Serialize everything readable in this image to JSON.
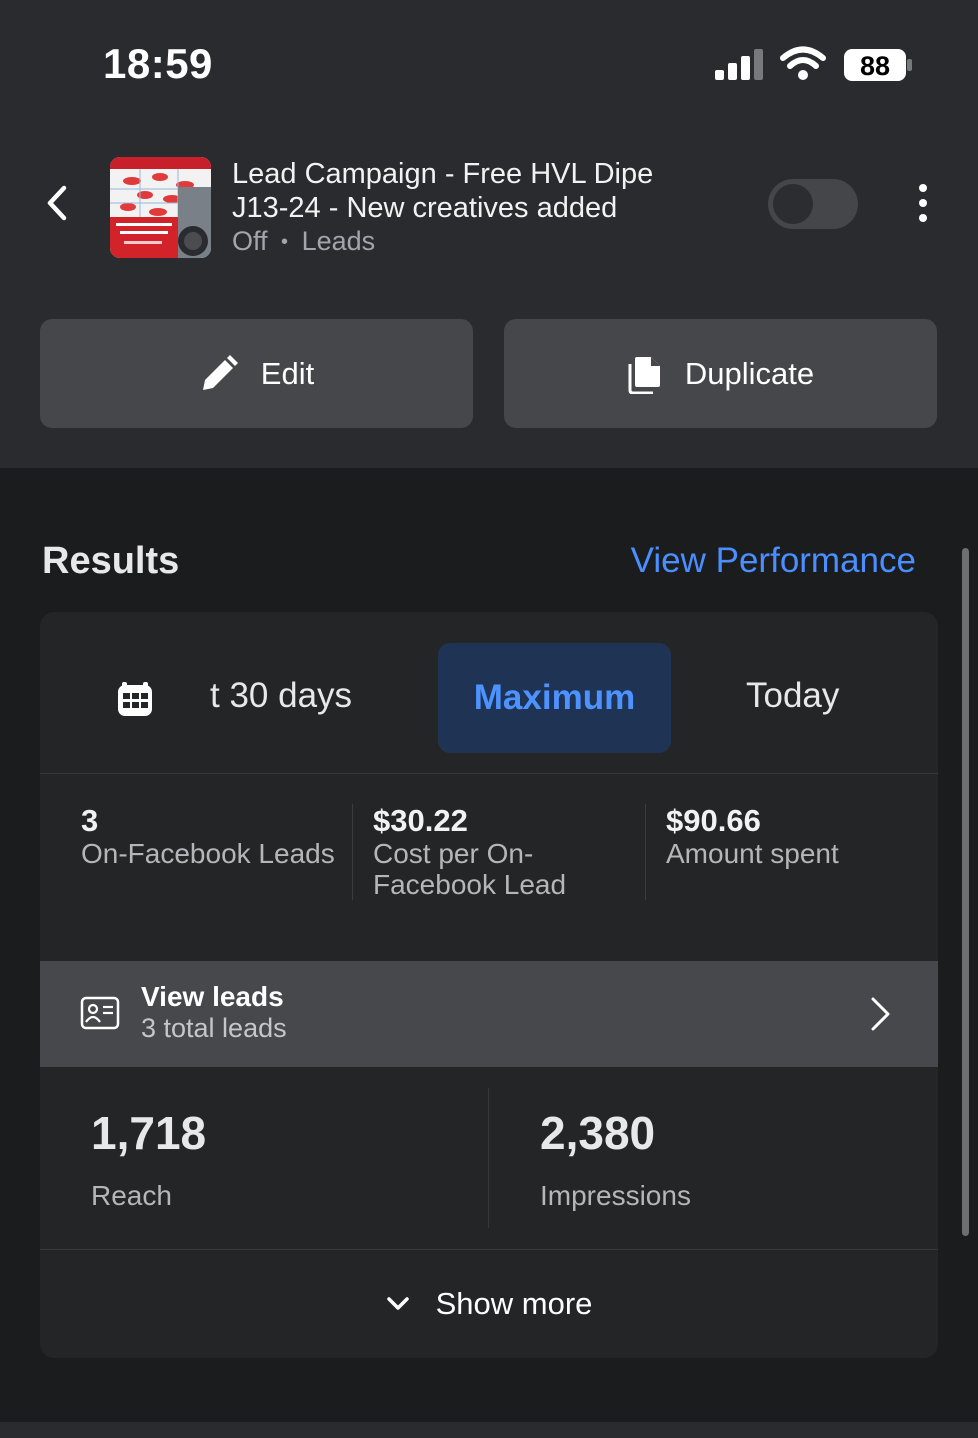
{
  "status_bar": {
    "time": "18:59",
    "battery": "88"
  },
  "campaign": {
    "title_line1": "Lead Campaign - Free HVL Dipe",
    "title_line2": "J13-24 - New creatives added",
    "status": "Off",
    "separator": "•",
    "objective": "Leads",
    "enabled": false
  },
  "actions": {
    "edit_label": "Edit",
    "duplicate_label": "Duplicate"
  },
  "results": {
    "heading": "Results",
    "view_performance": "View Performance",
    "tabs": [
      {
        "label": "t 30 days",
        "selected": false
      },
      {
        "label": "Maximum",
        "selected": true
      },
      {
        "label": "Today",
        "selected": false
      }
    ],
    "metrics": [
      {
        "value": "3",
        "label": "On-Facebook Leads"
      },
      {
        "value": "$30.22",
        "label": "Cost per On-Facebook Lead"
      },
      {
        "value": "$90.66",
        "label": "Amount spent"
      }
    ],
    "leads": {
      "title": "View leads",
      "subtitle": "3 total leads"
    },
    "reach": {
      "value": "1,718",
      "label": "Reach"
    },
    "impressions": {
      "value": "2,380",
      "label": "Impressions"
    },
    "show_more": "Show more"
  },
  "colors": {
    "accent": "#4a8eff",
    "selected_tab_bg": "#1f3455",
    "button_bg": "#46474b"
  },
  "icons": [
    "back-arrow-icon",
    "pencil-icon",
    "duplicate-icon",
    "calendar-icon",
    "contact-card-icon",
    "chevron-right-icon",
    "chevron-down-icon",
    "more-vertical-icon"
  ]
}
